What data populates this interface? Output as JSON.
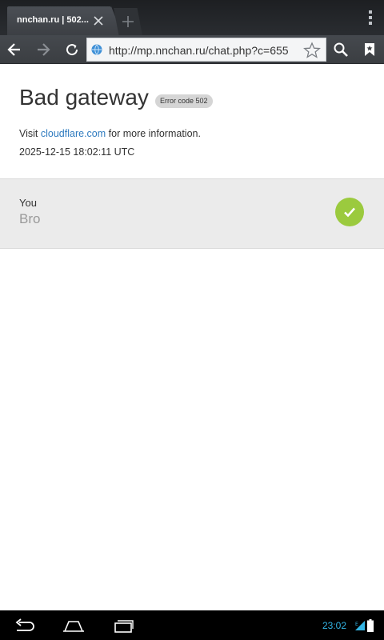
{
  "browser": {
    "tab": {
      "title": "nnchan.ru | 502..."
    },
    "url": "http://mp.nnchan.ru/chat.php?c=655"
  },
  "page": {
    "title": "Bad gateway",
    "error_badge": "Error code 502",
    "info": {
      "prefix": "Visit ",
      "link": "cloudflare.com",
      "suffix": " for more information."
    },
    "timestamp": "2025-12-15 18:02:11 UTC",
    "status_row": {
      "label": "You",
      "value": "Bro",
      "status_icon": "check-icon",
      "status_color": "#9bca3e"
    }
  },
  "system_bar": {
    "time": "23:02"
  },
  "colors": {
    "accent_link": "#2f7bbf",
    "clock": "#33b5e5",
    "success": "#9bca3e"
  }
}
